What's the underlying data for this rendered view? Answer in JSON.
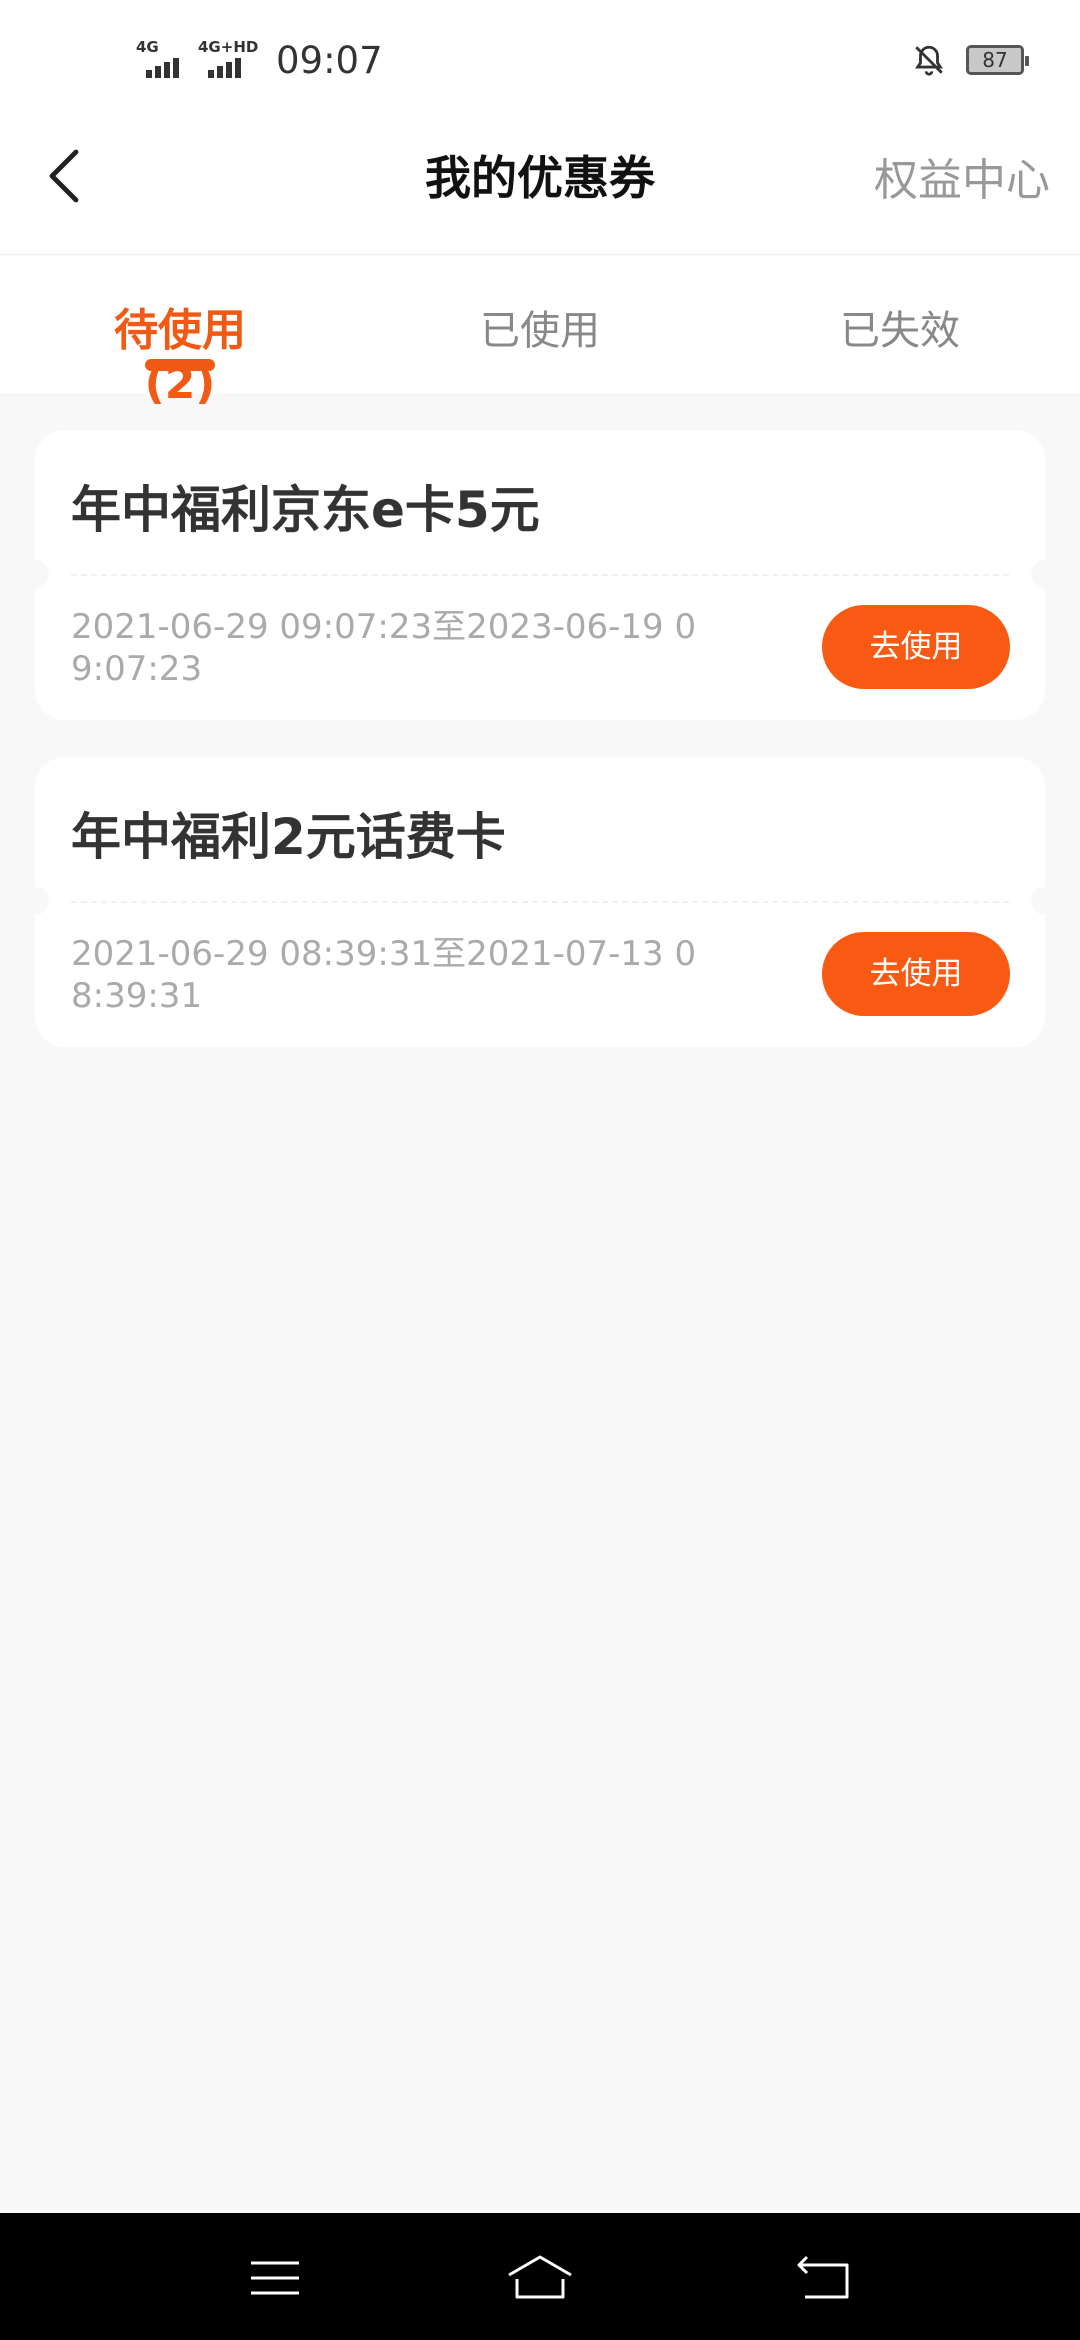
{
  "status_bar": {
    "sim1_label": "4G",
    "sim2_label": "4G+HD",
    "time": "09:07",
    "battery": "87"
  },
  "header": {
    "title": "我的优惠券",
    "right_action": "权益中心"
  },
  "tabs": [
    {
      "label": "待使用(2)",
      "active": true
    },
    {
      "label": "已使用",
      "active": false
    },
    {
      "label": "已失效",
      "active": false
    }
  ],
  "coupons": [
    {
      "title": "年中福利京东e卡5元",
      "validity": "2021-06-29 09:07:23至2023-06-19 09:07:23",
      "button": "去使用"
    },
    {
      "title": "年中福利2元话费卡",
      "validity": "2021-06-29 08:39:31至2021-07-13 08:39:31",
      "button": "去使用"
    }
  ],
  "colors": {
    "accent": "#f05a14",
    "button": "#f85a14",
    "background": "#f8f8f8"
  },
  "icons": {
    "back": "chevron-left-icon",
    "bell_muted": "bell-off-icon",
    "sys_menu": "menu-icon",
    "sys_home": "home-icon",
    "sys_back": "back-icon"
  }
}
